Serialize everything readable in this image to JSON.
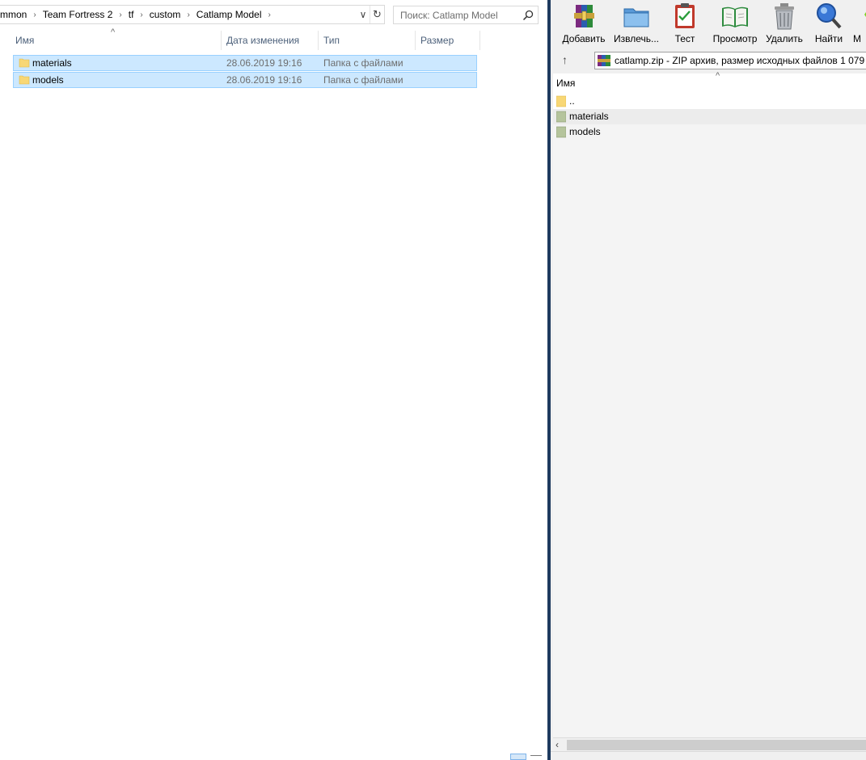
{
  "explorer": {
    "breadcrumb": [
      "mmon",
      "Team Fortress 2",
      "tf",
      "custom",
      "Catlamp Model"
    ],
    "search": {
      "placeholder": "Поиск: Catlamp Model"
    },
    "columns": {
      "name": "Имя",
      "date": "Дата изменения",
      "type": "Тип",
      "size": "Размер"
    },
    "rows": [
      {
        "name": "materials",
        "date": "28.06.2019 19:16",
        "type": "Папка с файлами"
      },
      {
        "name": "models",
        "date": "28.06.2019 19:16",
        "type": "Папка с файлами"
      }
    ]
  },
  "winrar": {
    "toolbar": {
      "add": "Добавить",
      "extract": "Извлечь...",
      "test": "Тест",
      "view": "Просмотр",
      "delete": "Удалить",
      "find": "Найти",
      "more": "М"
    },
    "path": "catlamp.zip - ZIP архив, размер исходных файлов 1 079 67",
    "columns": {
      "name": "Имя"
    },
    "items": [
      {
        "name": ".."
      },
      {
        "name": "materials"
      },
      {
        "name": "models"
      }
    ]
  },
  "colors": {
    "selection_bg": "#cce8ff",
    "selection_border": "#99d1ff",
    "folder_yellow": "#f8d775",
    "archive_folder": "#b5c49c",
    "divider": "#1e3a5f"
  },
  "icons": {
    "search": "search-icon",
    "folder": "folder-icon",
    "refresh": "refresh-icon",
    "up": "up-arrow-icon"
  }
}
